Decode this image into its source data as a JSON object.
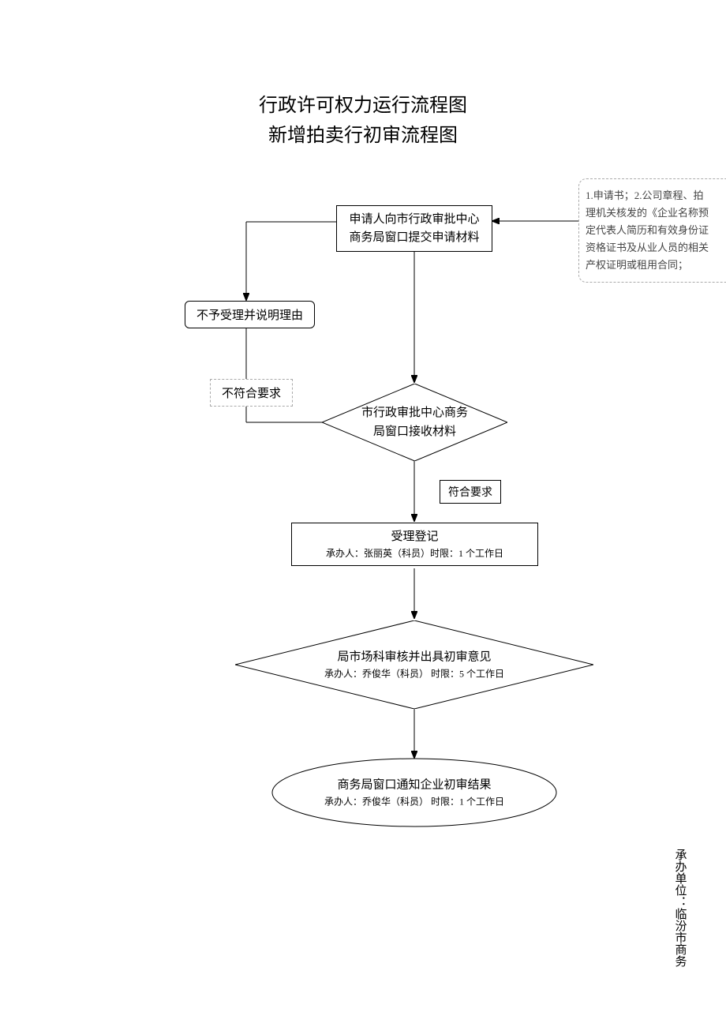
{
  "title": {
    "line1": "行政许可权力运行流程图",
    "line2": "新增拍卖行初审流程图"
  },
  "nodes": {
    "submit": {
      "line1": "申请人向市行政审批中心",
      "line2": "商务局窗口提交申请材料"
    },
    "reject": "不予受理并说明理由",
    "notPass": "不符合要求",
    "receive": {
      "line1": "市行政审批中心商务",
      "line2": "局窗口接收材料"
    },
    "passLabel": "符合要求",
    "accept": {
      "title": "受理登记",
      "sub": "承办人：张丽英（科员）时限：1 个工作日"
    },
    "review": {
      "title": "局市场科审核并出具初审意见",
      "sub": "承办人：乔俊华（科员）  时限：5 个工作日"
    },
    "notify": {
      "title": "商务局窗口通知企业初审结果",
      "sub": "承办人：乔俊华（科员）  时限：1 个工作日"
    }
  },
  "notes": {
    "l1": "1.申请书；2.公司章程、拍",
    "l2": "理机关核发的《企业名称预",
    "l3": "定代表人简历和有效身份证",
    "l4": "资格证书及从业人员的相关",
    "l5": "产权证明或租用合同；"
  },
  "footer": "承办单位：临汾市商务"
}
